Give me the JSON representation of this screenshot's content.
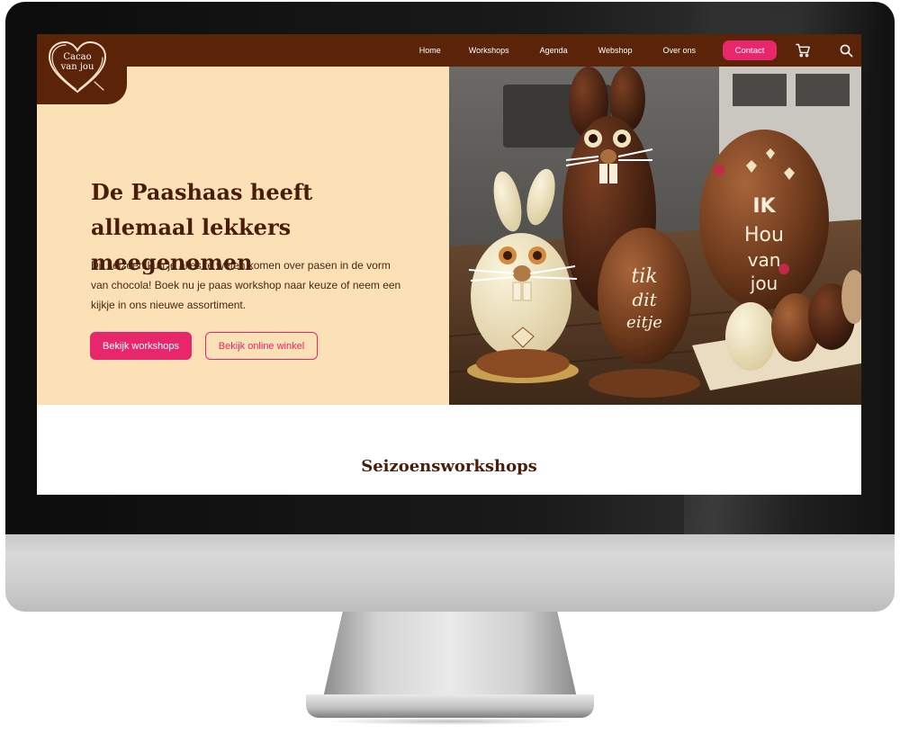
{
  "brand": {
    "logo_text": "Cacao van jou",
    "logo_line1": "Cacao",
    "logo_line2": "van jou"
  },
  "nav": {
    "items": [
      {
        "label": "Home"
      },
      {
        "label": "Workshops"
      },
      {
        "label": "Agenda"
      },
      {
        "label": "Webshop"
      },
      {
        "label": "Over ons"
      }
    ],
    "contact_label": "Contact",
    "icons": [
      "cart-icon",
      "search-icon"
    ]
  },
  "hero": {
    "title": "De Paashaas heeft allemaal lekkers meegenomen",
    "text": "Dit seizoen kun je alles te weten komen over pasen in de vorm van chocola! Boek nu je paas workshop naar keuze of neem een kijkje in ons nieuwe assortiment.",
    "primary_button": "Bekijk workshops",
    "secondary_button": "Bekijk online winkel",
    "photo": {
      "egg_text_left": "tik dit eitje",
      "egg_text_right": "IK Hou van jou",
      "badge_text": "Cacao van jou"
    }
  },
  "section": {
    "title": "Seizoensworkshops"
  },
  "colors": {
    "header_brown": "#5b2408",
    "accent_pink": "#e8266c",
    "hero_cream": "#fde1b6",
    "text_brown": "#4a1d0a"
  }
}
